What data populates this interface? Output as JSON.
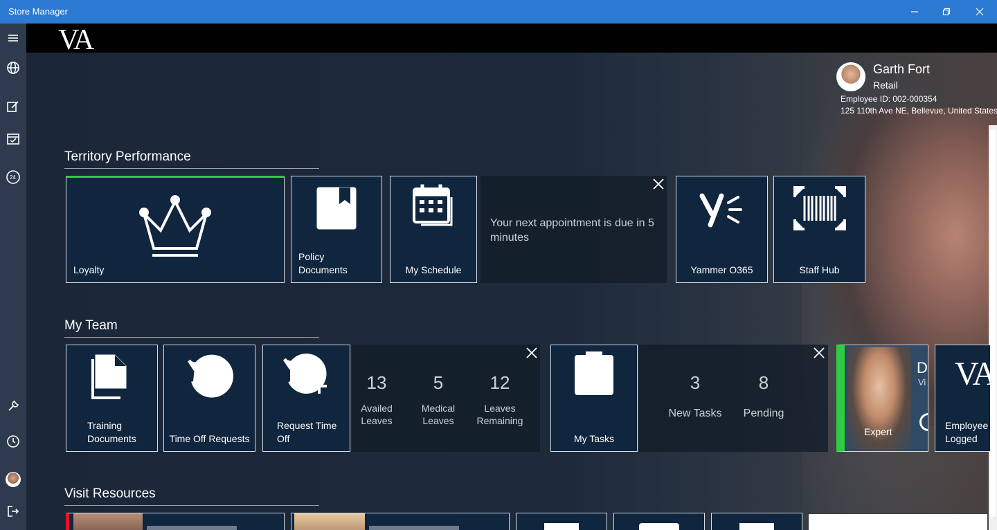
{
  "window": {
    "title": "Store Manager"
  },
  "brand": {
    "logo_text": "VA"
  },
  "profile": {
    "name": "Garth Fort",
    "role": "Retail",
    "employee_id": "Employee ID: 002-000354",
    "address": "125 110th Ave NE, Bellevue, United States"
  },
  "sections": {
    "territory": "Territory Performance",
    "team": "My Team",
    "visit": "Visit Resources"
  },
  "territory_tiles": {
    "loyalty": "Loyalty",
    "policy": "Policy Documents",
    "schedule": "My Schedule",
    "appointment_note": "Your next appointment is due in 5 minutes",
    "yammer": "Yammer O365",
    "staffhub": "Staff Hub"
  },
  "team_tiles": {
    "training": "Training Documents",
    "timeoff": "Time Off Requests",
    "request": "Request Time Off",
    "leaves": [
      {
        "value": "13",
        "label": "Availed Leaves"
      },
      {
        "value": "5",
        "label": "Medical Leaves"
      },
      {
        "value": "12",
        "label": "Leaves Remaining"
      }
    ],
    "tasks": "My Tasks",
    "task_stats": [
      {
        "value": "3",
        "label": "New Tasks"
      },
      {
        "value": "8",
        "label": "Pending"
      }
    ],
    "expert_label": "Expert",
    "expert_partial": "D",
    "expert_partial2": "Vi",
    "employee_logged": "Employee Logged",
    "employee_logo": "VA"
  },
  "colors": {
    "titlebar": "#2b79d0",
    "rail": "#2e3b4e",
    "tile": "#10253e",
    "accent_green": "#2ecc40",
    "accent_red": "#e81123"
  }
}
